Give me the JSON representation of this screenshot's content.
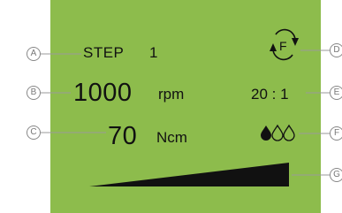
{
  "display": {
    "step_label": "STEP",
    "step_number": "1",
    "speed_value": "1000",
    "speed_unit": "rpm",
    "torque_value": "70",
    "torque_unit": "Ncm",
    "gear_ratio": "20 : 1",
    "rotation_direction_letter": "F",
    "rotation_direction_icon": "forward-rotation-icon",
    "irrigation_icon": "water-drops-icon",
    "irrigation_level": 1,
    "irrigation_max": 3,
    "power_bar_icon": "ramp-bar-icon",
    "screen_color": "#8dbc4c",
    "ink_color": "#111111"
  },
  "callouts": {
    "a": "A",
    "b": "B",
    "c": "C",
    "d": "D",
    "e": "E",
    "f": "F",
    "g": "G"
  }
}
